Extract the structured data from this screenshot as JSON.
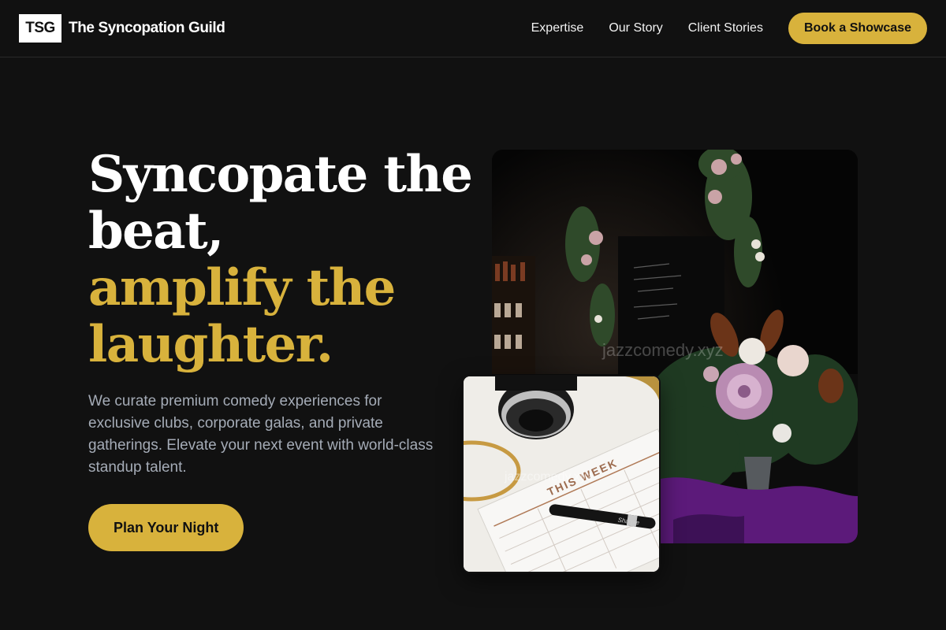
{
  "header": {
    "logo_text": "TSG",
    "brand_name": "The Syncopation Guild",
    "nav_links": [
      "Expertise",
      "Our Story",
      "Client Stories"
    ],
    "cta_label": "Book a Showcase"
  },
  "hero": {
    "headline_white": [
      "Syncopate the",
      "beat,"
    ],
    "headline_gold": [
      "amplify the",
      "laughter."
    ],
    "description": "We curate premium comedy experiences for exclusive clubs, corporate galas, and private gatherings. Elevate your next event with world-class standup talent.",
    "cta_label": "Plan Your Night"
  },
  "images": {
    "main_watermark": "jazzcomedy.xyz",
    "planner_heading": "THIS WEEK",
    "planner_watermark": "jazzcomedy.xyz",
    "pen_label": "Sharpie"
  },
  "colors": {
    "background": "#111111",
    "accent_gold": "#d8b23c",
    "text_muted": "#a5acb7"
  }
}
